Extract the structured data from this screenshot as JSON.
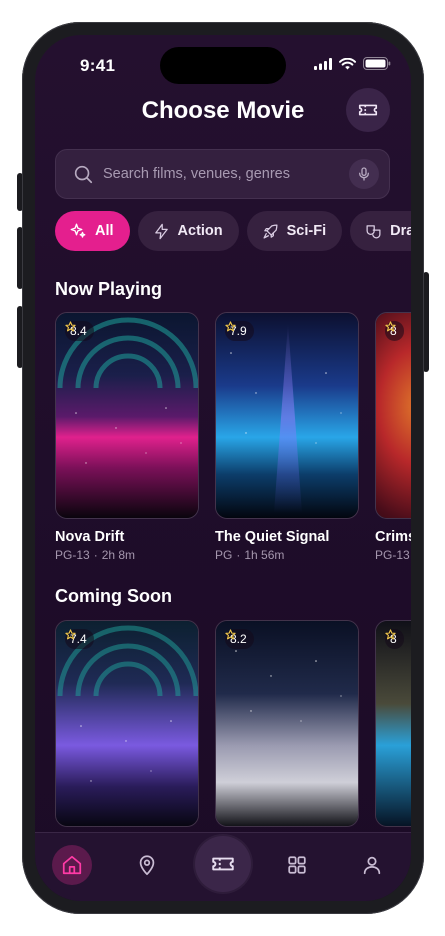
{
  "status_bar": {
    "time": "9:41"
  },
  "header": {
    "title": "Choose Movie"
  },
  "search": {
    "placeholder": "Search films, venues, genres"
  },
  "chips": [
    {
      "label": "All",
      "icon": "sparkles-icon",
      "active": true
    },
    {
      "label": "Action",
      "icon": "lightning-icon",
      "active": false
    },
    {
      "label": "Sci-Fi",
      "icon": "rocket-icon",
      "active": false
    },
    {
      "label": "Dram",
      "icon": "drama-masks-icon",
      "active": false
    }
  ],
  "sections": {
    "now_playing": {
      "title": "Now Playing",
      "movies": [
        {
          "title": "Nova Drift",
          "rating": "8.4",
          "certificate": "PG-13",
          "duration": "2h 8m"
        },
        {
          "title": "The Quiet Signal",
          "rating": "7.9",
          "certificate": "PG",
          "duration": "1h 56m"
        },
        {
          "title": "Crims",
          "rating": "8",
          "certificate": "PG-13",
          "duration": ""
        }
      ]
    },
    "coming_soon": {
      "title": "Coming Soon",
      "movies": [
        {
          "rating": "7.4"
        },
        {
          "rating": "8.2"
        },
        {
          "rating": "8"
        }
      ]
    }
  },
  "nav": {
    "items": [
      {
        "icon": "home-icon",
        "active": true
      },
      {
        "icon": "location-pin-icon",
        "active": false
      },
      {
        "icon": "ticket-icon",
        "active": false
      },
      {
        "icon": "grid-icon",
        "active": false
      },
      {
        "icon": "user-icon",
        "active": false
      }
    ]
  },
  "colors": {
    "accent": "#e41f8e",
    "background": "#1f0d2a",
    "surface": "#34203f",
    "star": "#f2c94c"
  }
}
